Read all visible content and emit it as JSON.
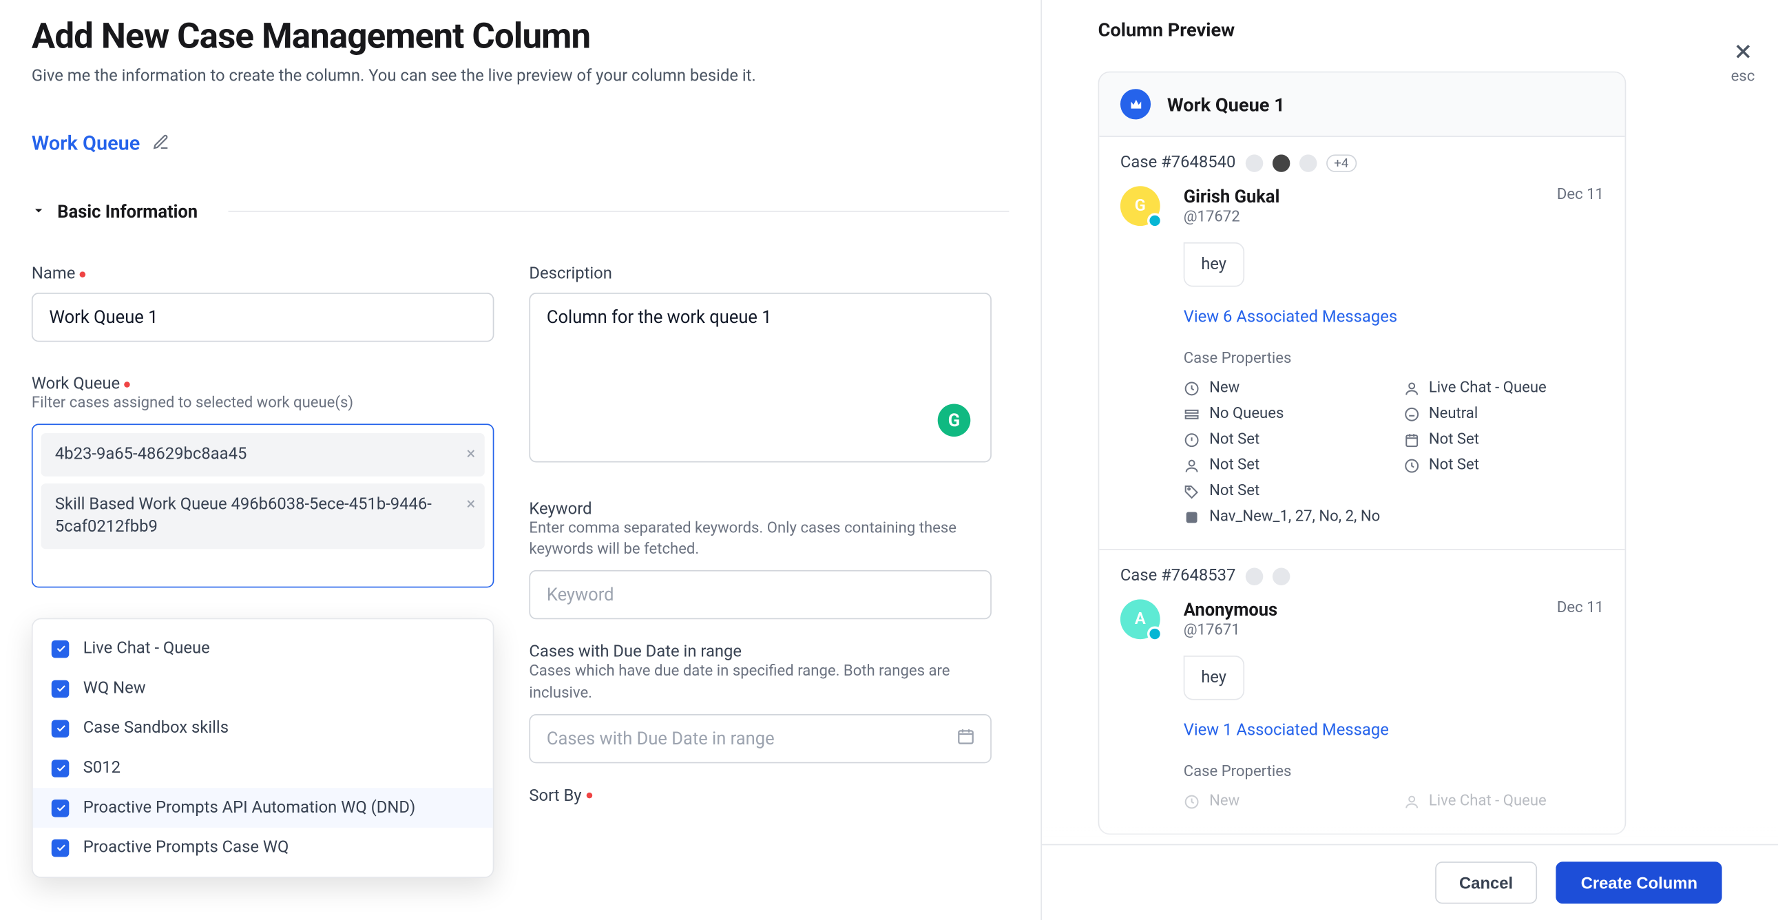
{
  "close": {
    "esc": "esc"
  },
  "header": {
    "title": "Add New Case Management Column",
    "subtitle": "Give me the information to create the column. You can see the live preview of your column beside it."
  },
  "queue_link": {
    "text": "Work Queue"
  },
  "section": {
    "basic_info": "Basic Information"
  },
  "form": {
    "name": {
      "label": "Name",
      "value": "Work Queue 1"
    },
    "description": {
      "label": "Description",
      "value": "Column for the work queue 1"
    },
    "work_queue": {
      "label": "Work Queue",
      "help": "Filter cases assigned to selected work queue(s)",
      "chips": [
        "4b23-9a65-48629bc8aa45",
        "Skill Based Work Queue 496b6038-5ece-451b-9446-5caf0212fbb9"
      ],
      "options": [
        {
          "label": "Live Chat - Queue",
          "checked": true
        },
        {
          "label": "WQ New",
          "checked": true
        },
        {
          "label": "Case Sandbox skills",
          "checked": true
        },
        {
          "label": "S012",
          "checked": true
        },
        {
          "label": "Proactive Prompts API Automation WQ (DND)",
          "checked": true
        },
        {
          "label": "Proactive Prompts Case WQ",
          "checked": true
        }
      ]
    },
    "keyword": {
      "label": "Keyword",
      "help": "Enter comma separated keywords. Only cases containing these keywords will be fetched.",
      "placeholder": "Keyword"
    },
    "due_date": {
      "label": "Cases with Due Date in range",
      "help": "Cases which have due date in specified range. Both ranges are inclusive.",
      "placeholder": "Cases with Due Date in range"
    },
    "sort_by": {
      "label": "Sort By"
    }
  },
  "preview": {
    "title": "Column Preview",
    "column_name": "Work Queue 1",
    "cases": [
      {
        "case_no": "Case #7648540",
        "extra_count": "+4",
        "name": "Girish Gukal",
        "initial": "G",
        "handle": "@17672",
        "date": "Dec 11",
        "msg": "hey",
        "assoc": "View 6 Associated Messages",
        "props_label": "Case Properties",
        "props": {
          "status": "New",
          "channel": "Live Chat - Queue",
          "queues": "No Queues",
          "sentiment": "Neutral",
          "p1": "Not Set",
          "p2": "Not Set",
          "p3": "Not Set",
          "p4": "Not Set",
          "p5": "Not Set"
        },
        "tags": "Nav_New_1, 27, No, 2, No"
      },
      {
        "case_no": "Case #7648537",
        "name": "Anonymous",
        "initial": "A",
        "handle": "@17671",
        "date": "Dec 11",
        "msg": "hey",
        "assoc": "View 1 Associated Message",
        "props_label": "Case Properties",
        "props": {
          "status": "New",
          "channel": "Live Chat - Queue"
        }
      }
    ]
  },
  "footer": {
    "cancel": "Cancel",
    "create": "Create Column"
  },
  "icons": {
    "grammarly": "G"
  }
}
